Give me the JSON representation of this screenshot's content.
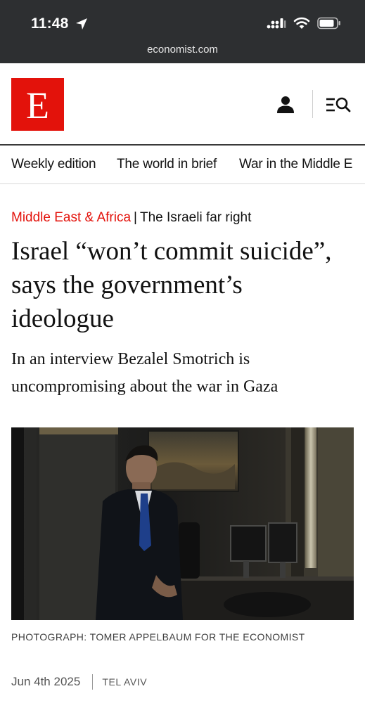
{
  "status_bar": {
    "time": "11:48",
    "url": "economist.com"
  },
  "header": {
    "logo_letter": "E",
    "brand_color": "#e3120b"
  },
  "nav": {
    "items": [
      {
        "label": "Weekly edition"
      },
      {
        "label": "The world in brief"
      },
      {
        "label": "War in the Middle E"
      }
    ]
  },
  "article": {
    "section": "Middle East & Africa",
    "separator": "|",
    "flytitle": "The Israeli far right",
    "headline": "Israel “won’t commit suicide”, says the government’s ideologue",
    "standfirst": "In an interview Bezalel Smotrich is uncompromising about the war in Gaza",
    "photo_caption": "PHOTOGRAPH: TOMER APPELBAUM FOR THE ECONOMIST",
    "date": "Jun 4th 2025",
    "location": "TEL AVIV"
  },
  "icons": {
    "location": "location-arrow-icon",
    "signal": "cellular-signal-icon",
    "wifi": "wifi-icon",
    "battery": "battery-icon",
    "account": "account-icon",
    "menu": "menu-search-icon"
  }
}
